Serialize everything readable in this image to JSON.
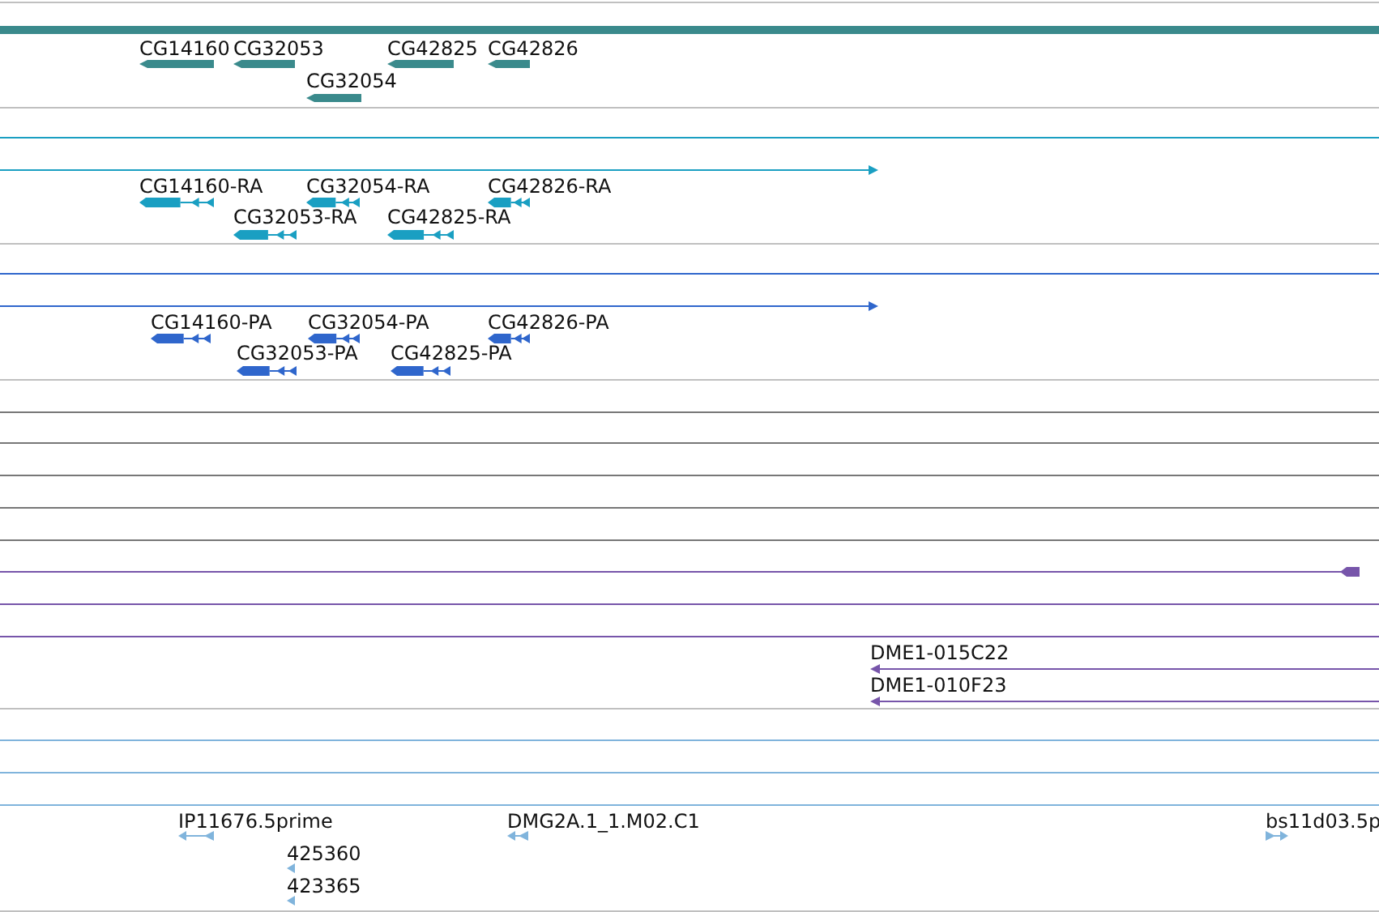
{
  "tracks": [
    {
      "kind": "gene",
      "color": "#3a8a8c",
      "features": [
        {
          "label": "CG14160",
          "reverse": true
        },
        {
          "label": "CG32053",
          "reverse": true
        },
        {
          "label": "CG42825",
          "reverse": true
        },
        {
          "label": "CG42826",
          "reverse": true
        },
        {
          "label": "CG32054",
          "reverse": true
        }
      ]
    },
    {
      "kind": "transcript",
      "color": "#1a9fc2",
      "features": [
        {
          "label": "CG14160-RA",
          "reverse": true
        },
        {
          "label": "CG32054-RA",
          "reverse": true
        },
        {
          "label": "CG42826-RA",
          "reverse": true
        },
        {
          "label": "CG32053-RA",
          "reverse": true
        },
        {
          "label": "CG42825-RA",
          "reverse": true
        }
      ]
    },
    {
      "kind": "transcript",
      "color": "#2f66cc",
      "features": [
        {
          "label": "CG14160-PA",
          "reverse": true
        },
        {
          "label": "CG32054-PA",
          "reverse": true
        },
        {
          "label": "CG42826-PA",
          "reverse": true
        },
        {
          "label": "CG32053-PA",
          "reverse": true
        },
        {
          "label": "CG42825-PA",
          "reverse": true
        }
      ]
    },
    {
      "kind": "clone",
      "color": "#7755aa",
      "features": [
        {
          "label": "DME1-015C22",
          "reverse": true
        },
        {
          "label": "DME1-010F23",
          "reverse": true
        }
      ]
    },
    {
      "kind": "est",
      "color": "#80b4dc",
      "features": [
        {
          "label": "IP11676.5prime",
          "reverse": true
        },
        {
          "label": "DMG2A.1_1.M02.C1",
          "reverse": true
        },
        {
          "label": "bs11d03.5p",
          "reverse": false
        },
        {
          "label": "425360",
          "reverse": true
        },
        {
          "label": "423365",
          "reverse": true
        }
      ]
    }
  ]
}
